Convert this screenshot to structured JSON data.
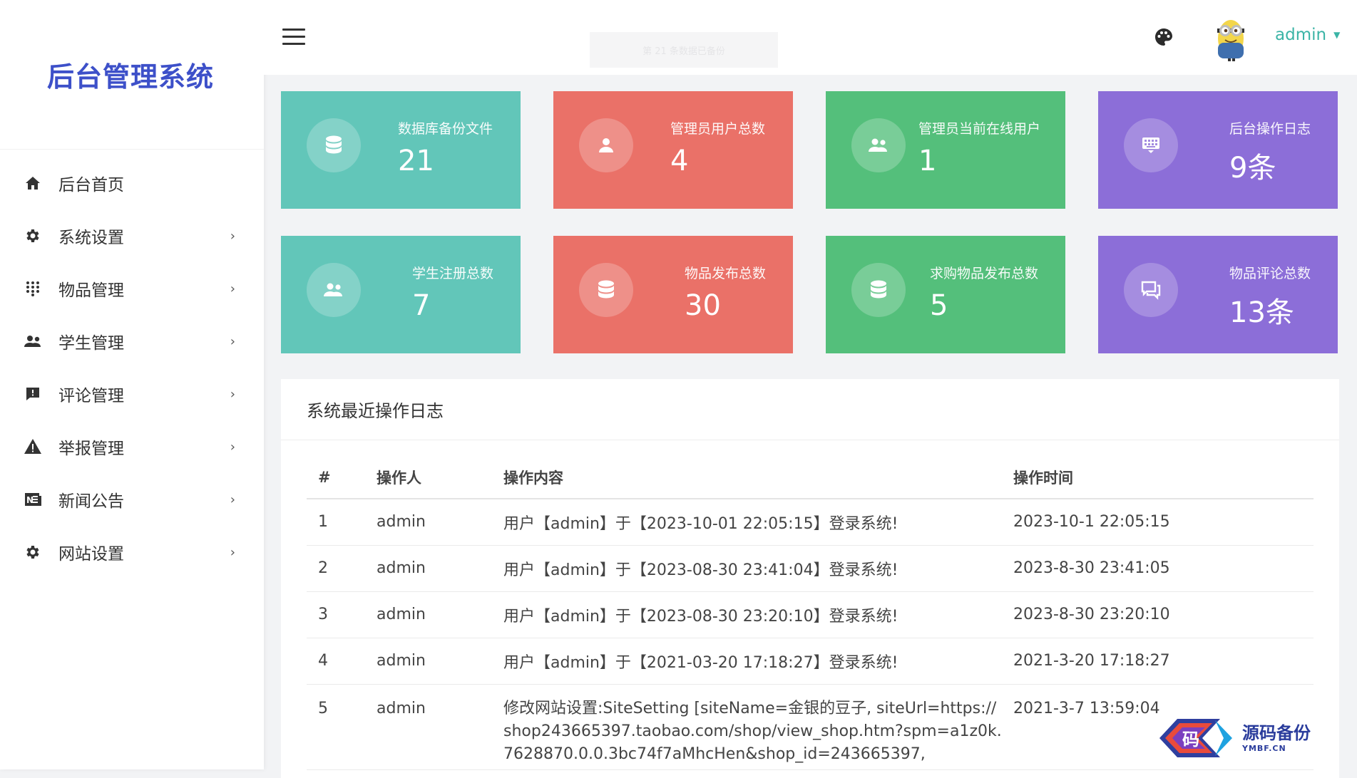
{
  "sidebar": {
    "brand": "后台管理系统",
    "items": [
      {
        "label": "后台首页",
        "icon": "home-icon"
      },
      {
        "label": "系统设置",
        "icon": "gear-icon"
      },
      {
        "label": "物品管理",
        "icon": "grid-icon"
      },
      {
        "label": "学生管理",
        "icon": "people-icon"
      },
      {
        "label": "评论管理",
        "icon": "comment-icon"
      },
      {
        "label": "举报管理",
        "icon": "warning-icon"
      },
      {
        "label": "新闻公告",
        "icon": "news-icon"
      },
      {
        "label": "网站设置",
        "icon": "gear-icon"
      }
    ]
  },
  "header": {
    "toast": "第 21 条数据已备份",
    "user": "admin"
  },
  "cards": [
    {
      "label": "数据库备份文件",
      "value": "21",
      "color": "#62c6b9",
      "icon": "database-icon"
    },
    {
      "label": "管理员用户总数",
      "value": "4",
      "color": "#ea7168",
      "icon": "person-icon"
    },
    {
      "label": "管理员当前在线用户",
      "value": "1",
      "color": "#54bf7b",
      "icon": "people-icon"
    },
    {
      "label": "后台操作日志",
      "value": "9条",
      "color": "#8c6ed8",
      "icon": "keyboard-icon"
    },
    {
      "label": "学生注册总数",
      "value": "7",
      "color": "#62c6b9",
      "icon": "people-icon"
    },
    {
      "label": "物品发布总数",
      "value": "30",
      "color": "#ea7168",
      "icon": "database-icon"
    },
    {
      "label": "求购物品发布总数",
      "value": "5",
      "color": "#54bf7b",
      "icon": "database-icon"
    },
    {
      "label": "物品评论总数",
      "value": "13条",
      "color": "#8c6ed8",
      "icon": "chat-icon"
    }
  ],
  "log": {
    "title": "系统最近操作日志",
    "columns": [
      "#",
      "操作人",
      "操作内容",
      "操作时间"
    ],
    "rows": [
      {
        "num": "1",
        "op": "admin",
        "content": "用户【admin】于【2023-10-01 22:05:15】登录系统!",
        "time": "2023-10-1 22:05:15"
      },
      {
        "num": "2",
        "op": "admin",
        "content": "用户【admin】于【2023-08-30 23:41:04】登录系统!",
        "time": "2023-8-30 23:41:05"
      },
      {
        "num": "3",
        "op": "admin",
        "content": "用户【admin】于【2023-08-30 23:20:10】登录系统!",
        "time": "2023-8-30 23:20:10"
      },
      {
        "num": "4",
        "op": "admin",
        "content": "用户【admin】于【2021-03-20 17:18:27】登录系统!",
        "time": "2021-3-20 17:18:27"
      },
      {
        "num": "5",
        "op": "admin",
        "content": "修改网站设置:SiteSetting [siteName=金银的豆子, siteUrl=https://shop243665397.taobao.com/shop/view_shop.htm?spm=a1z0k.7628870.0.0.3bc74f7aMhcHen&shop_id=243665397,",
        "time": "2021-3-7 13:59:04"
      }
    ]
  },
  "watermark": {
    "cn": "源码备份",
    "en": "YMBF.CN",
    "badge": "码"
  }
}
